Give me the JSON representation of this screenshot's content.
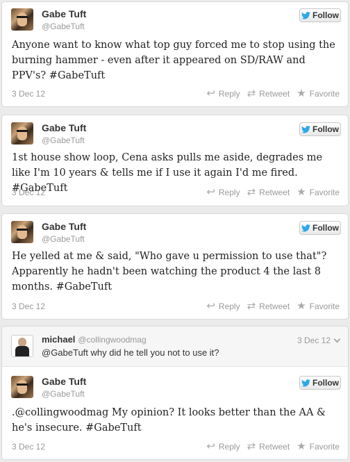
{
  "follow_label": "Follow",
  "actions": {
    "reply": "Reply",
    "retweet": "Retweet",
    "favorite": "Favorite"
  },
  "tweets": [
    {
      "name": "Gabe Tuft",
      "handle": "@GabeTuft",
      "text": "Anyone want to know what top guy forced me to stop using the burning hammer - even after it appeared on SD/RAW and PPV's? #GabeTuft",
      "date": "3 Dec 12"
    },
    {
      "name": "Gabe Tuft",
      "handle": "@GabeTuft",
      "text": "1st house show loop, Cena asks pulls me aside, degrades me like I'm 10 years & tells me if I use it again I'd me fired. #GabeTuft",
      "date": "3 Dec 12"
    },
    {
      "name": "Gabe Tuft",
      "handle": "@GabeTuft",
      "text": "He yelled at me & said, \"Who gave u permission to use that\"? Apparently he hadn't been watching the product 4 the last 8 months. #GabeTuft",
      "date": "3 Dec 12"
    },
    {
      "name": "Gabe Tuft",
      "handle": "@GabeTuft",
      "text": ".@collingwoodmag My opinion? It looks better than the AA & he's insecure. #GabeTuft",
      "date": "3 Dec 12"
    }
  ],
  "reply": {
    "name": "michael",
    "handle": "@collingwoodmag",
    "text": "@GabeTuft why did he tell you not to use it?",
    "date": "3 Dec 12"
  },
  "colors": {
    "twitter_blue": "#2fa8e6",
    "muted": "#999999"
  },
  "icons": [
    "twitter-bird-icon",
    "reply-icon",
    "retweet-icon",
    "star-icon",
    "chevron-down-icon"
  ]
}
